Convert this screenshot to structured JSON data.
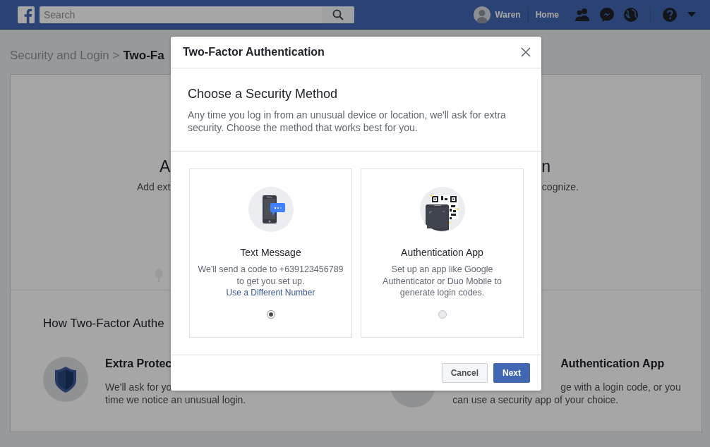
{
  "topbar": {
    "search": {
      "placeholder": "Search"
    },
    "user_name": "Waren",
    "home": "Home"
  },
  "page": {
    "breadcrumb": {
      "parent": "Security and Login >",
      "current": "Two-Fa"
    },
    "hero": {
      "heading_start": "A",
      "heading_end": "n",
      "text_start": "Add ext",
      "text_end": "cognize."
    },
    "how": {
      "heading": "How Two-Factor Authe",
      "features": [
        {
          "kind": "shield",
          "title": "Extra Protec",
          "lines": [
            "We'll ask for yo",
            "time we notice an unusual login."
          ]
        },
        {
          "kind": "app",
          "title": "Authentication App",
          "lines": [
            "ge with a login code, or you",
            "can use a security app of your choice."
          ]
        }
      ]
    }
  },
  "dialog": {
    "title": "Two-Factor Authentication",
    "heading": "Choose a Security Method",
    "description": "Any time you log in from an unusual device or location, we'll ask for extra security. Choose the method that works best for you.",
    "methods": [
      {
        "kind": "sms",
        "title": "Text Message",
        "description": "We'll send a code to +639123456789 to get you set up.",
        "link": "Use a Different Number",
        "selected": true
      },
      {
        "kind": "app",
        "title": "Authentication App",
        "description": "Set up an app like Google Authenticator or Duo Mobile to generate login codes.",
        "selected": false
      }
    ],
    "buttons": [
      {
        "label": "Cancel",
        "kind": "secondary"
      },
      {
        "label": "Next",
        "kind": "primary"
      }
    ]
  }
}
